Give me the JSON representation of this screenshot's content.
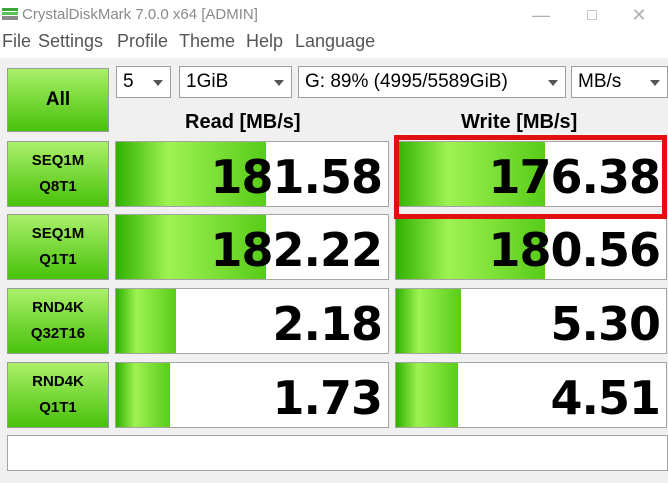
{
  "window": {
    "title": "CrystalDiskMark 7.0.0 x64 [ADMIN]",
    "minimize_glyph": "—",
    "close_glyph": "✕"
  },
  "menu": [
    "File",
    "Settings",
    "Profile",
    "Theme",
    "Help",
    "Language"
  ],
  "controls": {
    "all_label": "All",
    "count": "5",
    "size": "1GiB",
    "drive": "G: 89% (4995/5589GiB)",
    "unit": "MB/s"
  },
  "columns": {
    "read": "Read [MB/s]",
    "write": "Write [MB/s]"
  },
  "tests": [
    {
      "line1": "SEQ1M",
      "line2": "Q8T1",
      "read": "181.58",
      "write": "176.38",
      "read_fill": 0.55,
      "write_fill": 0.55
    },
    {
      "line1": "SEQ1M",
      "line2": "Q1T1",
      "read": "182.22",
      "write": "180.56",
      "read_fill": 0.55,
      "write_fill": 0.55
    },
    {
      "line1": "RND4K",
      "line2": "Q32T16",
      "read": "2.18",
      "write": "5.30",
      "read_fill": 0.22,
      "write_fill": 0.24
    },
    {
      "line1": "RND4K",
      "line2": "Q1T1",
      "read": "1.73",
      "write": "4.51",
      "read_fill": 0.2,
      "write_fill": 0.23
    }
  ],
  "comment": "",
  "colors": {
    "accent_green": "#48c20a",
    "highlight": "#e01010"
  }
}
